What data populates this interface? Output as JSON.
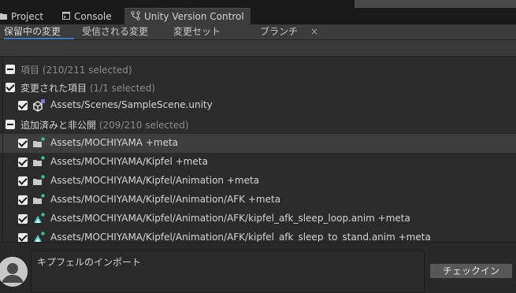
{
  "window_tabs": [
    {
      "label": "Project",
      "icon": "folder-icon"
    },
    {
      "label": "Console",
      "icon": "console-icon"
    },
    {
      "label": "Unity Version Control",
      "icon": "branch-icon",
      "active": true
    }
  ],
  "subtabs": [
    {
      "label": "保留中の変更",
      "active": true
    },
    {
      "label": "受信される変更"
    },
    {
      "label": "変更セット"
    },
    {
      "label": "ブランチ"
    }
  ],
  "close_label": "×",
  "tree": {
    "root": {
      "label": "項目",
      "count": "(210/211 selected)"
    },
    "changed_group": {
      "label": "変更された項目",
      "count": "(1/1 selected)"
    },
    "changed_items": [
      "Assets/Scenes/SampleScene.unity"
    ],
    "added_group": {
      "label": "追加済みと非公開",
      "count": "(209/210 selected)"
    },
    "added_items": [
      "Assets/MOCHIYAMA +meta",
      "Assets/MOCHIYAMA/Kipfel +meta",
      "Assets/MOCHIYAMA/Kipfel/Animation +meta",
      "Assets/MOCHIYAMA/Kipfel/Animation/AFK +meta",
      "Assets/MOCHIYAMA/Kipfel/Animation/AFK/kipfel_afk_sleep_loop.anim +meta",
      "Assets/MOCHIYAMA/Kipfel/Animation/AFK/kipfel_afk_sleep_to_stand.anim +meta"
    ]
  },
  "comment": {
    "text": "キプフェルのインポート"
  },
  "checkin_button": "チェックイン",
  "colors": {
    "accent": "#3a79bb",
    "added_badge": "#2ec27e",
    "changed_badge": "#8a6fd6"
  }
}
